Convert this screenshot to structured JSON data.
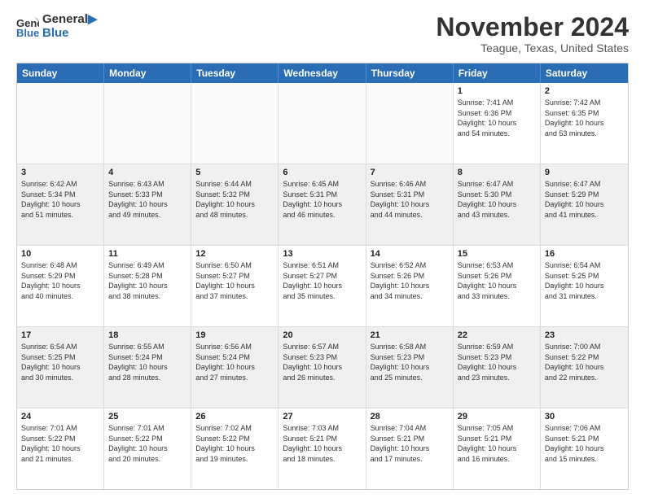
{
  "header": {
    "logo_line1": "General",
    "logo_line2": "Blue",
    "month_title": "November 2024",
    "location": "Teague, Texas, United States"
  },
  "weekdays": [
    "Sunday",
    "Monday",
    "Tuesday",
    "Wednesday",
    "Thursday",
    "Friday",
    "Saturday"
  ],
  "weeks": [
    [
      {
        "day": "",
        "info": ""
      },
      {
        "day": "",
        "info": ""
      },
      {
        "day": "",
        "info": ""
      },
      {
        "day": "",
        "info": ""
      },
      {
        "day": "",
        "info": ""
      },
      {
        "day": "1",
        "info": "Sunrise: 7:41 AM\nSunset: 6:36 PM\nDaylight: 10 hours\nand 54 minutes."
      },
      {
        "day": "2",
        "info": "Sunrise: 7:42 AM\nSunset: 6:35 PM\nDaylight: 10 hours\nand 53 minutes."
      }
    ],
    [
      {
        "day": "3",
        "info": "Sunrise: 6:42 AM\nSunset: 5:34 PM\nDaylight: 10 hours\nand 51 minutes."
      },
      {
        "day": "4",
        "info": "Sunrise: 6:43 AM\nSunset: 5:33 PM\nDaylight: 10 hours\nand 49 minutes."
      },
      {
        "day": "5",
        "info": "Sunrise: 6:44 AM\nSunset: 5:32 PM\nDaylight: 10 hours\nand 48 minutes."
      },
      {
        "day": "6",
        "info": "Sunrise: 6:45 AM\nSunset: 5:31 PM\nDaylight: 10 hours\nand 46 minutes."
      },
      {
        "day": "7",
        "info": "Sunrise: 6:46 AM\nSunset: 5:31 PM\nDaylight: 10 hours\nand 44 minutes."
      },
      {
        "day": "8",
        "info": "Sunrise: 6:47 AM\nSunset: 5:30 PM\nDaylight: 10 hours\nand 43 minutes."
      },
      {
        "day": "9",
        "info": "Sunrise: 6:47 AM\nSunset: 5:29 PM\nDaylight: 10 hours\nand 41 minutes."
      }
    ],
    [
      {
        "day": "10",
        "info": "Sunrise: 6:48 AM\nSunset: 5:29 PM\nDaylight: 10 hours\nand 40 minutes."
      },
      {
        "day": "11",
        "info": "Sunrise: 6:49 AM\nSunset: 5:28 PM\nDaylight: 10 hours\nand 38 minutes."
      },
      {
        "day": "12",
        "info": "Sunrise: 6:50 AM\nSunset: 5:27 PM\nDaylight: 10 hours\nand 37 minutes."
      },
      {
        "day": "13",
        "info": "Sunrise: 6:51 AM\nSunset: 5:27 PM\nDaylight: 10 hours\nand 35 minutes."
      },
      {
        "day": "14",
        "info": "Sunrise: 6:52 AM\nSunset: 5:26 PM\nDaylight: 10 hours\nand 34 minutes."
      },
      {
        "day": "15",
        "info": "Sunrise: 6:53 AM\nSunset: 5:26 PM\nDaylight: 10 hours\nand 33 minutes."
      },
      {
        "day": "16",
        "info": "Sunrise: 6:54 AM\nSunset: 5:25 PM\nDaylight: 10 hours\nand 31 minutes."
      }
    ],
    [
      {
        "day": "17",
        "info": "Sunrise: 6:54 AM\nSunset: 5:25 PM\nDaylight: 10 hours\nand 30 minutes."
      },
      {
        "day": "18",
        "info": "Sunrise: 6:55 AM\nSunset: 5:24 PM\nDaylight: 10 hours\nand 28 minutes."
      },
      {
        "day": "19",
        "info": "Sunrise: 6:56 AM\nSunset: 5:24 PM\nDaylight: 10 hours\nand 27 minutes."
      },
      {
        "day": "20",
        "info": "Sunrise: 6:57 AM\nSunset: 5:23 PM\nDaylight: 10 hours\nand 26 minutes."
      },
      {
        "day": "21",
        "info": "Sunrise: 6:58 AM\nSunset: 5:23 PM\nDaylight: 10 hours\nand 25 minutes."
      },
      {
        "day": "22",
        "info": "Sunrise: 6:59 AM\nSunset: 5:23 PM\nDaylight: 10 hours\nand 23 minutes."
      },
      {
        "day": "23",
        "info": "Sunrise: 7:00 AM\nSunset: 5:22 PM\nDaylight: 10 hours\nand 22 minutes."
      }
    ],
    [
      {
        "day": "24",
        "info": "Sunrise: 7:01 AM\nSunset: 5:22 PM\nDaylight: 10 hours\nand 21 minutes."
      },
      {
        "day": "25",
        "info": "Sunrise: 7:01 AM\nSunset: 5:22 PM\nDaylight: 10 hours\nand 20 minutes."
      },
      {
        "day": "26",
        "info": "Sunrise: 7:02 AM\nSunset: 5:22 PM\nDaylight: 10 hours\nand 19 minutes."
      },
      {
        "day": "27",
        "info": "Sunrise: 7:03 AM\nSunset: 5:21 PM\nDaylight: 10 hours\nand 18 minutes."
      },
      {
        "day": "28",
        "info": "Sunrise: 7:04 AM\nSunset: 5:21 PM\nDaylight: 10 hours\nand 17 minutes."
      },
      {
        "day": "29",
        "info": "Sunrise: 7:05 AM\nSunset: 5:21 PM\nDaylight: 10 hours\nand 16 minutes."
      },
      {
        "day": "30",
        "info": "Sunrise: 7:06 AM\nSunset: 5:21 PM\nDaylight: 10 hours\nand 15 minutes."
      }
    ]
  ]
}
